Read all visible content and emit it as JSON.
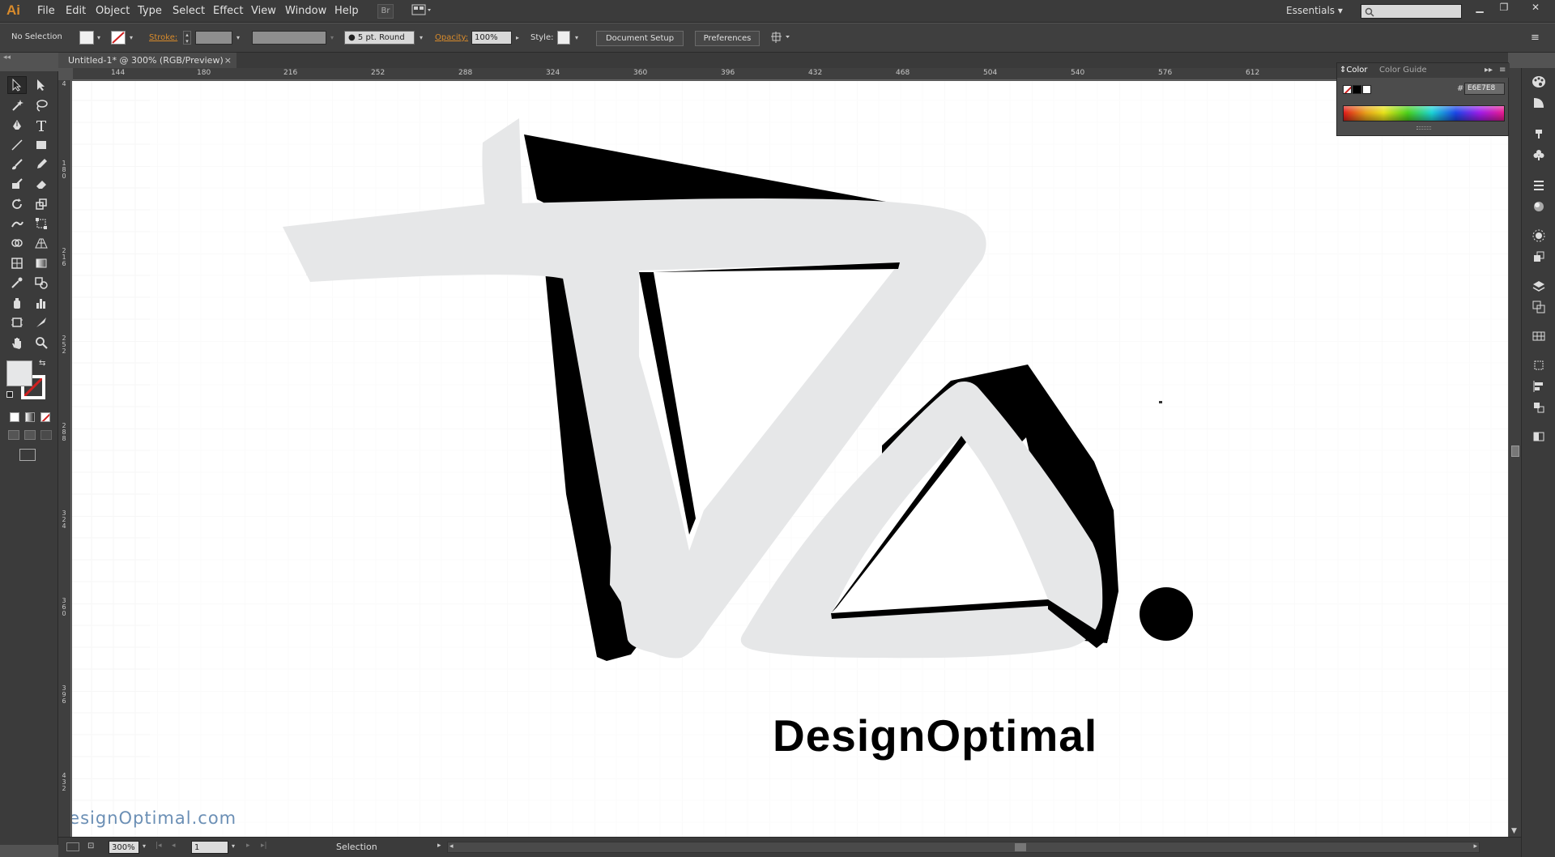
{
  "app": {
    "logo": "Ai"
  },
  "menu": {
    "items": [
      "File",
      "Edit",
      "Object",
      "Type",
      "Select",
      "Effect",
      "View",
      "Window",
      "Help"
    ],
    "bridge_label": "Br",
    "workspace": "Essentials"
  },
  "control_bar": {
    "selection_status": "No Selection",
    "stroke_label": "Stroke:",
    "brush_label": "5 pt. Round",
    "opacity_label": "Opacity:",
    "opacity_value": "100%",
    "style_label": "Style:",
    "document_setup": "Document Setup",
    "preferences": "Preferences"
  },
  "document": {
    "tab_title": "Untitled-1* @ 300% (RGB/Preview)",
    "close_glyph": "×"
  },
  "rulers": {
    "top": [
      "144",
      "180",
      "216",
      "252",
      "288",
      "324",
      "360",
      "396",
      "432",
      "468",
      "504",
      "540",
      "576",
      "612"
    ],
    "left": [
      "4",
      "180",
      "216",
      "252",
      "288",
      "324",
      "360",
      "396",
      "432"
    ]
  },
  "artwork": {
    "brand_text": "DesignOptimal",
    "watermark": "DesignOptimal.com",
    "fill_color": "#E6E7E8",
    "shadow_color": "#000000"
  },
  "color_panel": {
    "tab_color": "Color",
    "tab_color_guide": "Color Guide",
    "hex_prefix": "#",
    "hex_value": "E6E7E8"
  },
  "status_bar": {
    "zoom": "300%",
    "page": "1",
    "tool_name": "Selection"
  },
  "icons": [
    "selection-arrow-icon",
    "direct-selection-icon",
    "magic-wand-icon",
    "lasso-icon",
    "pen-icon",
    "type-icon",
    "line-icon",
    "rectangle-icon",
    "paintbrush-icon",
    "pencil-icon",
    "blob-brush-icon",
    "eraser-icon",
    "rotate-icon",
    "scale-icon",
    "warp-icon",
    "free-transform-icon",
    "shape-builder-icon",
    "perspective-grid-icon",
    "mesh-icon",
    "gradient-icon",
    "eyedropper-icon",
    "blend-icon",
    "symbol-sprayer-icon",
    "graph-icon",
    "artboard-icon",
    "slice-icon",
    "hand-icon",
    "zoom-icon",
    "search-icon"
  ]
}
